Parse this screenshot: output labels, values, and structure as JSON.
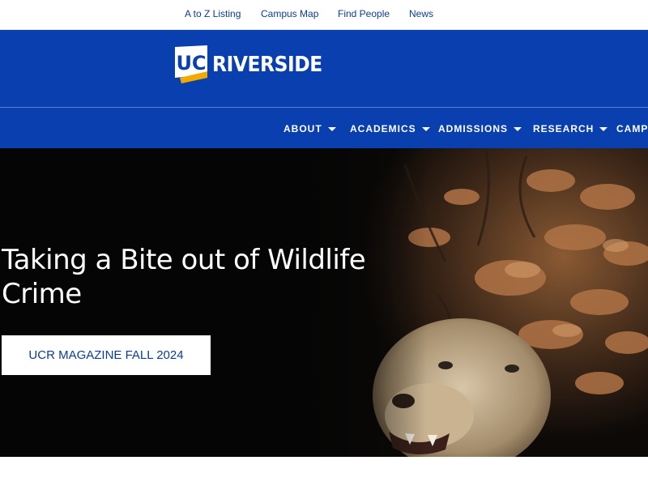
{
  "utility_nav": {
    "items": [
      {
        "label": "A to Z Listing"
      },
      {
        "label": "Campus Map"
      },
      {
        "label": "Find People"
      },
      {
        "label": "News"
      }
    ]
  },
  "brand": {
    "logo_text": "RIVERSIDE",
    "logo_mark_text": "UC",
    "color": "#0a3fb0",
    "accent_color": "#f1ab00"
  },
  "main_nav": {
    "items": [
      {
        "label": "ABOUT"
      },
      {
        "label": "ACADEMICS"
      },
      {
        "label": "ADMISSIONS"
      },
      {
        "label": "RESEARCH"
      },
      {
        "label": "CAMPU"
      }
    ]
  },
  "hero": {
    "title": "Taking a Bite out of Wildlife Crime",
    "cta_label": "UCR MAGAZINE FALL 2024"
  }
}
